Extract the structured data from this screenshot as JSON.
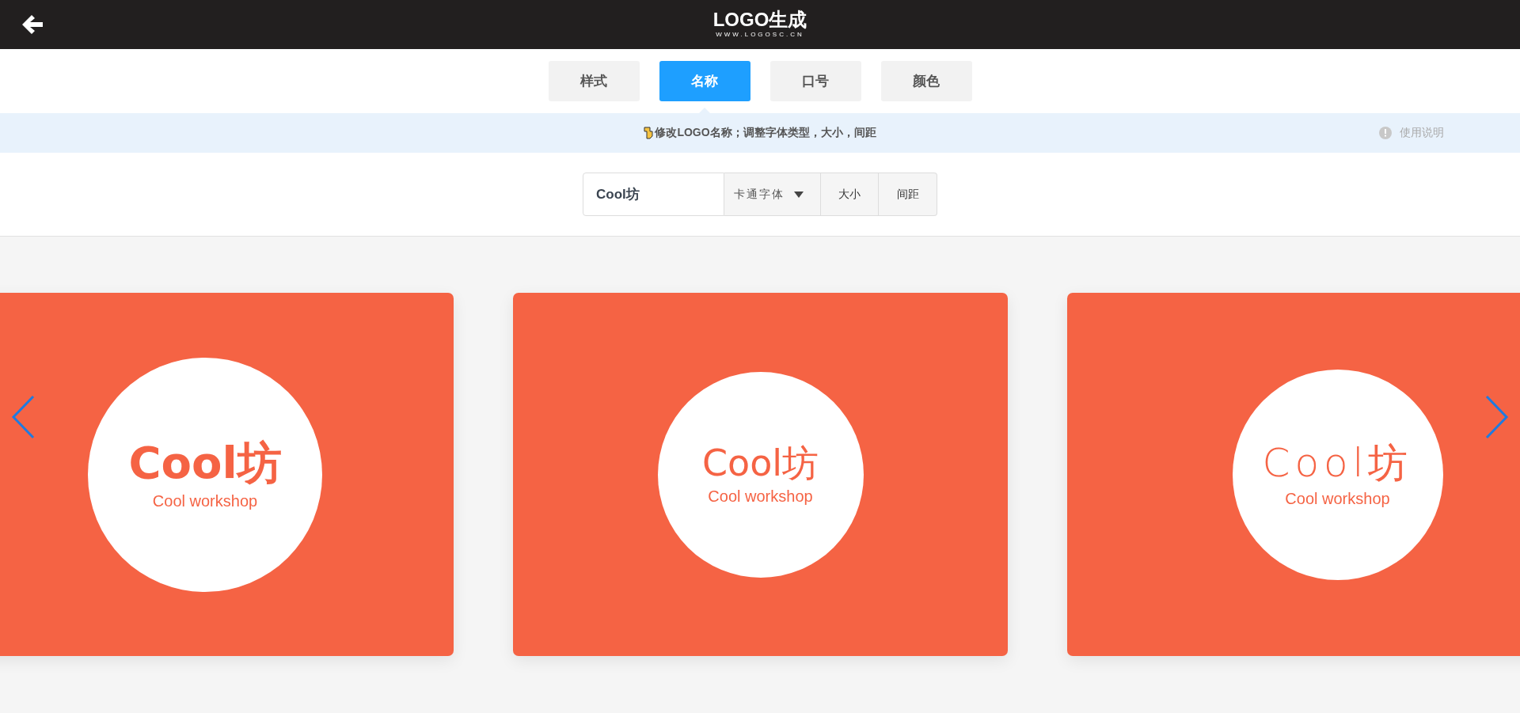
{
  "header": {
    "logo": "LOGO生成",
    "url": "WWW.LOGOSC.CN"
  },
  "tabs": [
    {
      "label": "样式",
      "selected": false
    },
    {
      "label": "名称",
      "selected": true
    },
    {
      "label": "口号",
      "selected": false
    },
    {
      "label": "颜色",
      "selected": false
    }
  ],
  "hint": {
    "text": "修改LOGO名称；调整字体类型，大小，间距",
    "help": "使用说明"
  },
  "controls": {
    "name_value": "Cool坊",
    "font": "卡通字体",
    "size": "大小",
    "spacing": "间距"
  },
  "cards": [
    {
      "kind": "bold",
      "title": "Cool坊",
      "subtitle": "Cool workshop"
    },
    {
      "kind": "cute",
      "title": "Cool坊",
      "subtitle": "Cool workshop"
    },
    {
      "kind": "hand",
      "title": "Cool坊",
      "subtitle": "Cool workshop"
    }
  ]
}
